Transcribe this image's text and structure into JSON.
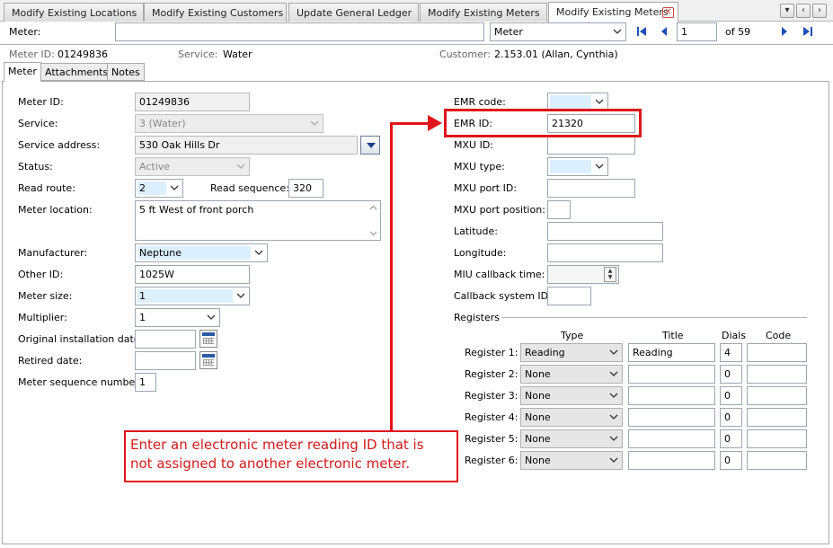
{
  "doc_tabs": [
    "Modify Existing Locations",
    "Modify Existing Customers",
    "Update General Ledger",
    "Modify Existing Meters",
    "Modify Existing Meters"
  ],
  "toolbar": {
    "meter_label": "Meter:",
    "search_value": "",
    "search_type": "Meter",
    "page_value": "1",
    "page_of": "of 59"
  },
  "summary": {
    "meter_id_label": "Meter ID:",
    "meter_id": "01249836",
    "service_label": "Service:",
    "service": "Water",
    "customer_label": "Customer:",
    "customer": "2.153.01  (Allan, Cynthia)"
  },
  "sub_tabs": [
    "Meter",
    "Attachments",
    "Notes"
  ],
  "left": {
    "meter_id": {
      "label": "Meter ID:",
      "value": "01249836"
    },
    "service": {
      "label": "Service:",
      "value": "3 (Water)"
    },
    "service_address": {
      "label": "Service address:",
      "value": "530 Oak Hills Dr"
    },
    "status": {
      "label": "Status:",
      "value": "Active"
    },
    "read_route": {
      "label": "Read route:",
      "value": "2"
    },
    "read_sequence": {
      "label": "Read sequence:",
      "value": "320"
    },
    "meter_location": {
      "label": "Meter location:",
      "value": "5 ft West of front porch"
    },
    "manufacturer": {
      "label": "Manufacturer:",
      "value": "Neptune"
    },
    "other_id": {
      "label": "Other ID:",
      "value": "1025W"
    },
    "meter_size": {
      "label": "Meter size:",
      "value": "1"
    },
    "multiplier": {
      "label": "Multiplier:",
      "value": "1"
    },
    "orig_install": {
      "label": "Original installation date:",
      "value": ""
    },
    "retired": {
      "label": "Retired date:",
      "value": ""
    },
    "meter_seq": {
      "label": "Meter sequence number:",
      "value": "1"
    }
  },
  "right": {
    "emr_code": {
      "label": "EMR code:",
      "value": ""
    },
    "emr_id": {
      "label": "EMR ID:",
      "value": "21320"
    },
    "mxu_id": {
      "label": "MXU ID:",
      "value": ""
    },
    "mxu_type": {
      "label": "MXU type:",
      "value": ""
    },
    "mxu_port_id": {
      "label": "MXU port ID:",
      "value": ""
    },
    "mxu_port_position": {
      "label": "MXU port position:",
      "value": ""
    },
    "latitude": {
      "label": "Latitude:",
      "value": ""
    },
    "longitude": {
      "label": "Longitude:",
      "value": ""
    },
    "miu_callback": {
      "label": "MIU callback time:",
      "value": ""
    },
    "callback_system_id": {
      "label": "Callback system ID:",
      "value": ""
    }
  },
  "registers": {
    "heading": "Registers",
    "columns": [
      "Type",
      "Title",
      "Dials",
      "Code"
    ],
    "rows": [
      {
        "label": "Register 1:",
        "type": "Reading",
        "title": "Reading",
        "dials": "4",
        "code": ""
      },
      {
        "label": "Register 2:",
        "type": "None",
        "title": "",
        "dials": "0",
        "code": ""
      },
      {
        "label": "Register 3:",
        "type": "None",
        "title": "",
        "dials": "0",
        "code": ""
      },
      {
        "label": "Register 4:",
        "type": "None",
        "title": "",
        "dials": "0",
        "code": ""
      },
      {
        "label": "Register 5:",
        "type": "None",
        "title": "",
        "dials": "0",
        "code": ""
      },
      {
        "label": "Register 6:",
        "type": "None",
        "title": "",
        "dials": "0",
        "code": ""
      }
    ]
  },
  "callout": {
    "line1": "Enter an electronic meter reading ID that is",
    "line2": "not assigned to another electronic meter."
  },
  "colors": {
    "annotation_red": "#e0151b",
    "nav_blue": "#1d4fb8",
    "combo_highlight": "#dcefff"
  }
}
